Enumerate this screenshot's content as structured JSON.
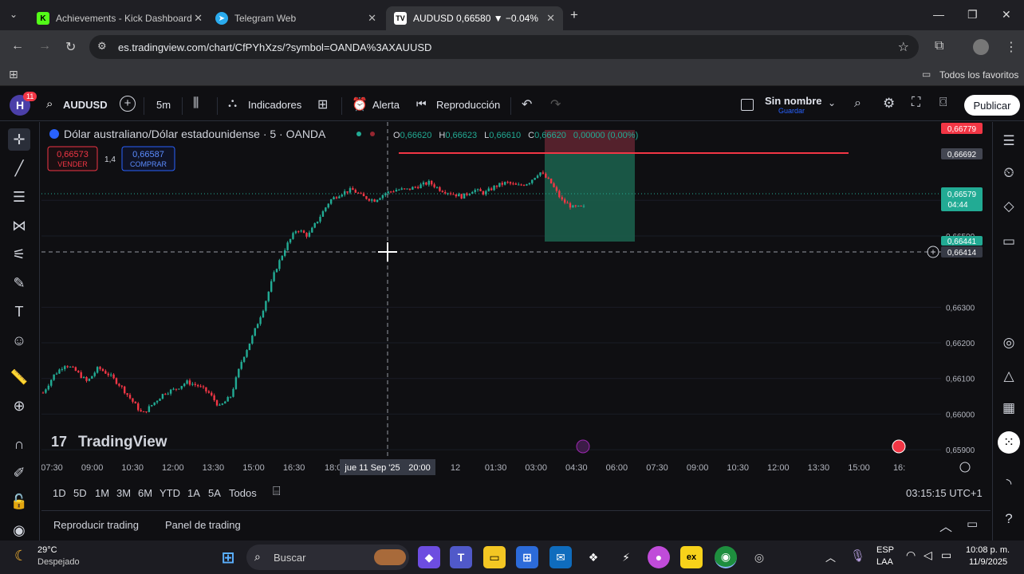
{
  "browser": {
    "tabs": [
      {
        "title": "Achievements - Kick Dashboard",
        "icon": "kick-icon",
        "color": "#53fc18"
      },
      {
        "title": "Telegram Web",
        "icon": "telegram-icon",
        "color": "#2aabee"
      },
      {
        "title": "AUDUSD 0,66580 ▼ −0.04% Si",
        "icon": "tradingview-icon",
        "color": "#ffffff"
      }
    ],
    "url": "es.tradingview.com/chart/CfPYhXzs/?symbol=OANDA%3AXAUUSD",
    "bookmarks_all": "Todos los favoritos"
  },
  "toolbar": {
    "avatar_letter": "H",
    "notif_count": "11",
    "symbol": "AUDUSD",
    "interval": "5m",
    "indicators": "Indicadores",
    "alert": "Alerta",
    "replay": "Reproducción",
    "layout_name": "Sin nombre",
    "layout_save": "Guardar",
    "publish": "Publicar"
  },
  "legend": {
    "title": "Dólar australiano/Dólar estadounidense · 5 · OANDA",
    "o": "0,66620",
    "h": "0,66623",
    "l": "0,66610",
    "c": "0,66620",
    "change": "0,00000 (0,00%)",
    "sell_price": "0,66573",
    "sell_label": "VENDER",
    "spread": "1,4",
    "buy_price": "0,66587",
    "buy_label": "COMPRAR"
  },
  "chart_data": {
    "type": "candlestick",
    "title": "Dólar australiano/Dólar estadounidense · 5 · OANDA",
    "y_ticks": [
      "0,65900",
      "0,66000",
      "0,66100",
      "0,66200",
      "0,66300",
      "0,66500",
      "0,66600"
    ],
    "x_ticks": [
      "07:30",
      "09:00",
      "10:30",
      "12:00",
      "13:30",
      "15:00",
      "16:30",
      "18:0",
      "20:00",
      "22:30",
      "12",
      "01:30",
      "03:00",
      "04:30",
      "06:00",
      "07:30",
      "09:00",
      "10:30",
      "12:00",
      "13:30",
      "15:00",
      "16:"
    ],
    "crosshair_date": "jue 11 Sep '25",
    "price_labels": {
      "target": "0,66779",
      "line": "0,66692",
      "current": "0,66579",
      "countdown": "04:44",
      "stop": "0,66441",
      "crosshair": "0,66414"
    },
    "ylim": [
      0.6588,
      0.6682
    ],
    "up_color": "#22ab94",
    "down_color": "#f23645",
    "close_path": [
      0.6606,
      0.6611,
      0.6614,
      0.6612,
      0.6609,
      0.6613,
      0.6611,
      0.6608,
      0.6604,
      0.66,
      0.6603,
      0.6606,
      0.6607,
      0.6609,
      0.6608,
      0.6606,
      0.6602,
      0.6605,
      0.6615,
      0.6622,
      0.663,
      0.664,
      0.6647,
      0.6652,
      0.665,
      0.6655,
      0.666,
      0.6662,
      0.6663,
      0.6661,
      0.666,
      0.6662,
      0.6663,
      0.6663,
      0.6664,
      0.6665,
      0.6663,
      0.6662,
      0.6661,
      0.6663,
      0.6662,
      0.6664,
      0.6665,
      0.6664,
      0.6665,
      0.6668,
      0.6665,
      0.666,
      0.6658,
      0.6658
    ],
    "position": {
      "entry": "0,66579",
      "target": "0,66779",
      "stop": "0,66441"
    }
  },
  "bottom": {
    "ranges": [
      "1D",
      "5D",
      "1M",
      "3M",
      "6M",
      "YTD",
      "1A",
      "5A",
      "Todos"
    ],
    "clock": "03:15:15 UTC+1",
    "replay_trading": "Reproducir trading",
    "trading_panel": "Panel de trading",
    "watermark": "TradingView"
  },
  "taskbar": {
    "temp": "29°C",
    "weather": "Despejado",
    "search": "Buscar",
    "lang1": "ESP",
    "lang2": "LAA",
    "time": "10:08 p. m.",
    "date": "11/9/2025"
  },
  "colors": {
    "bg": "#0f0f12",
    "grid": "#1e222d",
    "red_line": "#f23645",
    "green_zone": "#1b5e4b",
    "red_zone": "#5c2330"
  }
}
